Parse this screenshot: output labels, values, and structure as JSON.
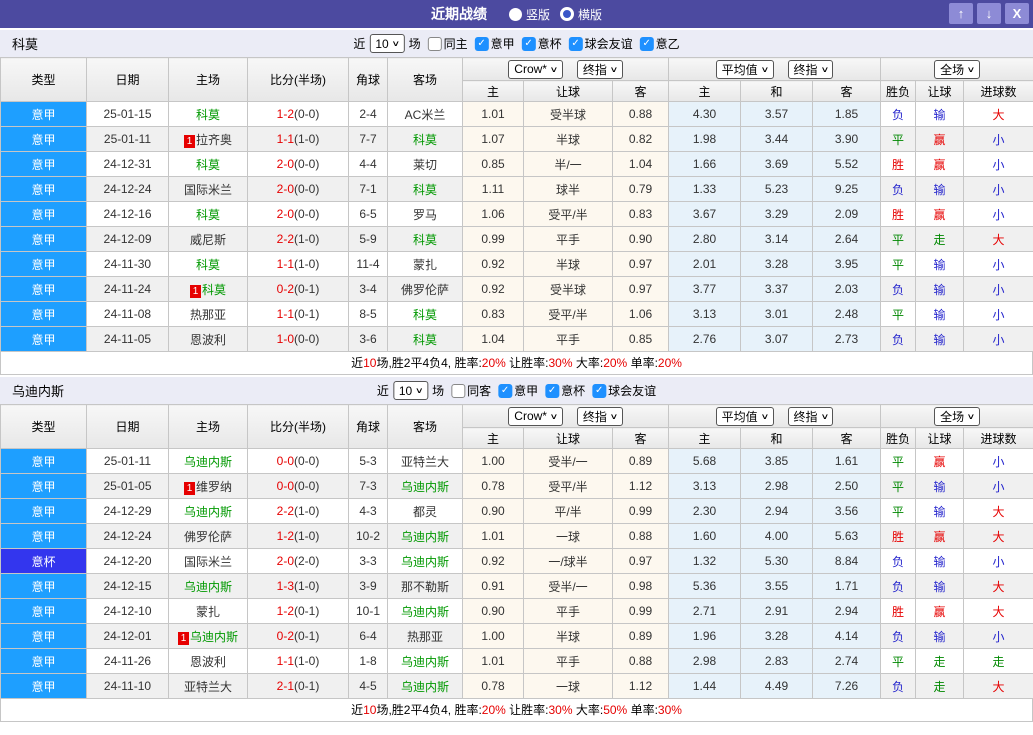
{
  "titlebar": {
    "title": "近期战绩",
    "vertical_label": "竖版",
    "horizontal_label": "横版",
    "selected_layout": "竖版",
    "up_glyph": "↑",
    "down_glyph": "↓",
    "close_glyph": "X"
  },
  "columns": {
    "type": "类型",
    "date": "日期",
    "home": "主场",
    "score": "比分(半场)",
    "corner": "角球",
    "away": "客场",
    "sub": [
      "主",
      "让球",
      "客",
      "主",
      "和",
      "客",
      "胜负",
      "让球",
      "进球数"
    ]
  },
  "colors": {
    "titlebar": "#4c4aa0",
    "league_badge": "#1e9fff",
    "cup_badge": "#3336ee",
    "focal_team_green": "#009900",
    "score_red": "#e60000",
    "result_red": "#e60000",
    "result_green": "#008800",
    "result_blue": "#2525cd",
    "odds_column_bg": "#fdf8ef",
    "average_column_bg": "#e7f2fa"
  },
  "sections": [
    {
      "team": "科莫",
      "filter": {
        "near": "近",
        "count": "10",
        "games": "场",
        "same_label": "同主",
        "same_checked": false,
        "leagues": [
          {
            "label": "意甲",
            "checked": true
          },
          {
            "label": "意杯",
            "checked": true
          },
          {
            "label": "球会友谊",
            "checked": true
          },
          {
            "label": "意乙",
            "checked": true
          }
        ]
      },
      "dropdowns": [
        "Crow*",
        "终指",
        "平均值",
        "终指",
        "全场"
      ],
      "rows": [
        {
          "type": "意甲",
          "cup": false,
          "date": "25-01-15",
          "home": "科莫",
          "home_focal": true,
          "home_rc": false,
          "score": "1-2",
          "half": "(0-0)",
          "corner": "2-4",
          "away": "AC米兰",
          "away_focal": false,
          "odds": [
            "1.01",
            "受半球",
            "0.88"
          ],
          "avg": [
            "4.30",
            "3.57",
            "1.85"
          ],
          "res": [
            [
              "负",
              "b"
            ],
            [
              "输",
              "b"
            ],
            [
              "大",
              "r"
            ]
          ]
        },
        {
          "type": "意甲",
          "cup": false,
          "date": "25-01-11",
          "home": "拉齐奥",
          "home_focal": false,
          "home_rc": true,
          "score": "1-1",
          "half": "(1-0)",
          "corner": "7-7",
          "away": "科莫",
          "away_focal": true,
          "odds": [
            "1.07",
            "半球",
            "0.82"
          ],
          "avg": [
            "1.98",
            "3.44",
            "3.90"
          ],
          "res": [
            [
              "平",
              "g"
            ],
            [
              "赢",
              "r"
            ],
            [
              "小",
              "b"
            ]
          ]
        },
        {
          "type": "意甲",
          "cup": false,
          "date": "24-12-31",
          "home": "科莫",
          "home_focal": true,
          "home_rc": false,
          "score": "2-0",
          "half": "(0-0)",
          "corner": "4-4",
          "away": "莱切",
          "away_focal": false,
          "odds": [
            "0.85",
            "半/一",
            "1.04"
          ],
          "avg": [
            "1.66",
            "3.69",
            "5.52"
          ],
          "res": [
            [
              "胜",
              "r"
            ],
            [
              "赢",
              "r"
            ],
            [
              "小",
              "b"
            ]
          ]
        },
        {
          "type": "意甲",
          "cup": false,
          "date": "24-12-24",
          "home": "国际米兰",
          "home_focal": false,
          "home_rc": false,
          "score": "2-0",
          "half": "(0-0)",
          "corner": "7-1",
          "away": "科莫",
          "away_focal": true,
          "odds": [
            "1.11",
            "球半",
            "0.79"
          ],
          "avg": [
            "1.33",
            "5.23",
            "9.25"
          ],
          "res": [
            [
              "负",
              "b"
            ],
            [
              "输",
              "b"
            ],
            [
              "小",
              "b"
            ]
          ]
        },
        {
          "type": "意甲",
          "cup": false,
          "date": "24-12-16",
          "home": "科莫",
          "home_focal": true,
          "home_rc": false,
          "score": "2-0",
          "half": "(0-0)",
          "corner": "6-5",
          "away": "罗马",
          "away_focal": false,
          "odds": [
            "1.06",
            "受平/半",
            "0.83"
          ],
          "avg": [
            "3.67",
            "3.29",
            "2.09"
          ],
          "res": [
            [
              "胜",
              "r"
            ],
            [
              "赢",
              "r"
            ],
            [
              "小",
              "b"
            ]
          ]
        },
        {
          "type": "意甲",
          "cup": false,
          "date": "24-12-09",
          "home": "威尼斯",
          "home_focal": false,
          "home_rc": false,
          "score": "2-2",
          "half": "(1-0)",
          "corner": "5-9",
          "away": "科莫",
          "away_focal": true,
          "odds": [
            "0.99",
            "平手",
            "0.90"
          ],
          "avg": [
            "2.80",
            "3.14",
            "2.64"
          ],
          "res": [
            [
              "平",
              "g"
            ],
            [
              "走",
              "g"
            ],
            [
              "大",
              "r"
            ]
          ]
        },
        {
          "type": "意甲",
          "cup": false,
          "date": "24-11-30",
          "home": "科莫",
          "home_focal": true,
          "home_rc": false,
          "score": "1-1",
          "half": "(1-0)",
          "corner": "11-4",
          "away": "蒙扎",
          "away_focal": false,
          "odds": [
            "0.92",
            "半球",
            "0.97"
          ],
          "avg": [
            "2.01",
            "3.28",
            "3.95"
          ],
          "res": [
            [
              "平",
              "g"
            ],
            [
              "输",
              "b"
            ],
            [
              "小",
              "b"
            ]
          ]
        },
        {
          "type": "意甲",
          "cup": false,
          "date": "24-11-24",
          "home": "科莫",
          "home_focal": true,
          "home_rc": true,
          "score": "0-2",
          "half": "(0-1)",
          "corner": "3-4",
          "away": "佛罗伦萨",
          "away_focal": false,
          "odds": [
            "0.92",
            "受半球",
            "0.97"
          ],
          "avg": [
            "3.77",
            "3.37",
            "2.03"
          ],
          "res": [
            [
              "负",
              "b"
            ],
            [
              "输",
              "b"
            ],
            [
              "小",
              "b"
            ]
          ]
        },
        {
          "type": "意甲",
          "cup": false,
          "date": "24-11-08",
          "home": "热那亚",
          "home_focal": false,
          "home_rc": false,
          "score": "1-1",
          "half": "(0-1)",
          "corner": "8-5",
          "away": "科莫",
          "away_focal": true,
          "odds": [
            "0.83",
            "受平/半",
            "1.06"
          ],
          "avg": [
            "3.13",
            "3.01",
            "2.48"
          ],
          "res": [
            [
              "平",
              "g"
            ],
            [
              "输",
              "b"
            ],
            [
              "小",
              "b"
            ]
          ]
        },
        {
          "type": "意甲",
          "cup": false,
          "date": "24-11-05",
          "home": "恩波利",
          "home_focal": false,
          "home_rc": false,
          "score": "1-0",
          "half": "(0-0)",
          "corner": "3-6",
          "away": "科莫",
          "away_focal": true,
          "odds": [
            "1.04",
            "平手",
            "0.85"
          ],
          "avg": [
            "2.76",
            "3.07",
            "2.73"
          ],
          "res": [
            [
              "负",
              "b"
            ],
            [
              "输",
              "b"
            ],
            [
              "小",
              "b"
            ]
          ]
        }
      ],
      "summary": [
        [
          "近",
          "k"
        ],
        [
          "10",
          "r"
        ],
        [
          "场,胜2平4负4, 胜率:",
          "k"
        ],
        [
          "20%",
          "r"
        ],
        [
          " 让胜率:",
          "k"
        ],
        [
          "30%",
          "r"
        ],
        [
          " 大率:",
          "k"
        ],
        [
          "20%",
          "r"
        ],
        [
          " 单率:",
          "k"
        ],
        [
          "20%",
          "r"
        ]
      ]
    },
    {
      "team": "乌迪内斯",
      "filter": {
        "near": "近",
        "count": "10",
        "games": "场",
        "same_label": "同客",
        "same_checked": false,
        "leagues": [
          {
            "label": "意甲",
            "checked": true
          },
          {
            "label": "意杯",
            "checked": true
          },
          {
            "label": "球会友谊",
            "checked": true
          }
        ]
      },
      "dropdowns": [
        "Crow*",
        "终指",
        "平均值",
        "终指",
        "全场"
      ],
      "rows": [
        {
          "type": "意甲",
          "cup": false,
          "date": "25-01-11",
          "home": "乌迪内斯",
          "home_focal": true,
          "home_rc": false,
          "score": "0-0",
          "half": "(0-0)",
          "corner": "5-3",
          "away": "亚特兰大",
          "away_focal": false,
          "odds": [
            "1.00",
            "受半/一",
            "0.89"
          ],
          "avg": [
            "5.68",
            "3.85",
            "1.61"
          ],
          "res": [
            [
              "平",
              "g"
            ],
            [
              "赢",
              "r"
            ],
            [
              "小",
              "b"
            ]
          ]
        },
        {
          "type": "意甲",
          "cup": false,
          "date": "25-01-05",
          "home": "维罗纳",
          "home_focal": false,
          "home_rc": true,
          "score": "0-0",
          "half": "(0-0)",
          "corner": "7-3",
          "away": "乌迪内斯",
          "away_focal": true,
          "odds": [
            "0.78",
            "受平/半",
            "1.12"
          ],
          "avg": [
            "3.13",
            "2.98",
            "2.50"
          ],
          "res": [
            [
              "平",
              "g"
            ],
            [
              "输",
              "b"
            ],
            [
              "小",
              "b"
            ]
          ]
        },
        {
          "type": "意甲",
          "cup": false,
          "date": "24-12-29",
          "home": "乌迪内斯",
          "home_focal": true,
          "home_rc": false,
          "score": "2-2",
          "half": "(1-0)",
          "corner": "4-3",
          "away": "都灵",
          "away_focal": false,
          "odds": [
            "0.90",
            "平/半",
            "0.99"
          ],
          "avg": [
            "2.30",
            "2.94",
            "3.56"
          ],
          "res": [
            [
              "平",
              "g"
            ],
            [
              "输",
              "b"
            ],
            [
              "大",
              "r"
            ]
          ]
        },
        {
          "type": "意甲",
          "cup": false,
          "date": "24-12-24",
          "home": "佛罗伦萨",
          "home_focal": false,
          "home_rc": false,
          "score": "1-2",
          "half": "(1-0)",
          "corner": "10-2",
          "away": "乌迪内斯",
          "away_focal": true,
          "odds": [
            "1.01",
            "一球",
            "0.88"
          ],
          "avg": [
            "1.60",
            "4.00",
            "5.63"
          ],
          "res": [
            [
              "胜",
              "r"
            ],
            [
              "赢",
              "r"
            ],
            [
              "大",
              "r"
            ]
          ]
        },
        {
          "type": "意杯",
          "cup": true,
          "date": "24-12-20",
          "home": "国际米兰",
          "home_focal": false,
          "home_rc": false,
          "score": "2-0",
          "half": "(2-0)",
          "corner": "3-3",
          "away": "乌迪内斯",
          "away_focal": true,
          "odds": [
            "0.92",
            "一/球半",
            "0.97"
          ],
          "avg": [
            "1.32",
            "5.30",
            "8.84"
          ],
          "res": [
            [
              "负",
              "b"
            ],
            [
              "输",
              "b"
            ],
            [
              "小",
              "b"
            ]
          ]
        },
        {
          "type": "意甲",
          "cup": false,
          "date": "24-12-15",
          "home": "乌迪内斯",
          "home_focal": true,
          "home_rc": false,
          "score": "1-3",
          "half": "(1-0)",
          "corner": "3-9",
          "away": "那不勒斯",
          "away_focal": false,
          "odds": [
            "0.91",
            "受半/一",
            "0.98"
          ],
          "avg": [
            "5.36",
            "3.55",
            "1.71"
          ],
          "res": [
            [
              "负",
              "b"
            ],
            [
              "输",
              "b"
            ],
            [
              "大",
              "r"
            ]
          ]
        },
        {
          "type": "意甲",
          "cup": false,
          "date": "24-12-10",
          "home": "蒙扎",
          "home_focal": false,
          "home_rc": false,
          "score": "1-2",
          "half": "(0-1)",
          "corner": "10-1",
          "away": "乌迪内斯",
          "away_focal": true,
          "odds": [
            "0.90",
            "平手",
            "0.99"
          ],
          "avg": [
            "2.71",
            "2.91",
            "2.94"
          ],
          "res": [
            [
              "胜",
              "r"
            ],
            [
              "赢",
              "r"
            ],
            [
              "大",
              "r"
            ]
          ]
        },
        {
          "type": "意甲",
          "cup": false,
          "date": "24-12-01",
          "home": "乌迪内斯",
          "home_focal": true,
          "home_rc": true,
          "score": "0-2",
          "half": "(0-1)",
          "corner": "6-4",
          "away": "热那亚",
          "away_focal": false,
          "odds": [
            "1.00",
            "半球",
            "0.89"
          ],
          "avg": [
            "1.96",
            "3.28",
            "4.14"
          ],
          "res": [
            [
              "负",
              "b"
            ],
            [
              "输",
              "b"
            ],
            [
              "小",
              "b"
            ]
          ]
        },
        {
          "type": "意甲",
          "cup": false,
          "date": "24-11-26",
          "home": "恩波利",
          "home_focal": false,
          "home_rc": false,
          "score": "1-1",
          "half": "(1-0)",
          "corner": "1-8",
          "away": "乌迪内斯",
          "away_focal": true,
          "odds": [
            "1.01",
            "平手",
            "0.88"
          ],
          "avg": [
            "2.98",
            "2.83",
            "2.74"
          ],
          "res": [
            [
              "平",
              "g"
            ],
            [
              "走",
              "g"
            ],
            [
              "走",
              "g"
            ]
          ]
        },
        {
          "type": "意甲",
          "cup": false,
          "date": "24-11-10",
          "home": "亚特兰大",
          "home_focal": false,
          "home_rc": false,
          "score": "2-1",
          "half": "(0-1)",
          "corner": "4-5",
          "away": "乌迪内斯",
          "away_focal": true,
          "odds": [
            "0.78",
            "一球",
            "1.12"
          ],
          "avg": [
            "1.44",
            "4.49",
            "7.26"
          ],
          "res": [
            [
              "负",
              "b"
            ],
            [
              "走",
              "g"
            ],
            [
              "大",
              "r"
            ]
          ]
        }
      ],
      "summary": [
        [
          "近",
          "k"
        ],
        [
          "10",
          "r"
        ],
        [
          "场,胜2平4负4, 胜率:",
          "k"
        ],
        [
          "20%",
          "r"
        ],
        [
          " 让胜率:",
          "k"
        ],
        [
          "30%",
          "r"
        ],
        [
          " 大率:",
          "k"
        ],
        [
          "50%",
          "r"
        ],
        [
          " 单率:",
          "k"
        ],
        [
          "30%",
          "r"
        ]
      ]
    }
  ]
}
